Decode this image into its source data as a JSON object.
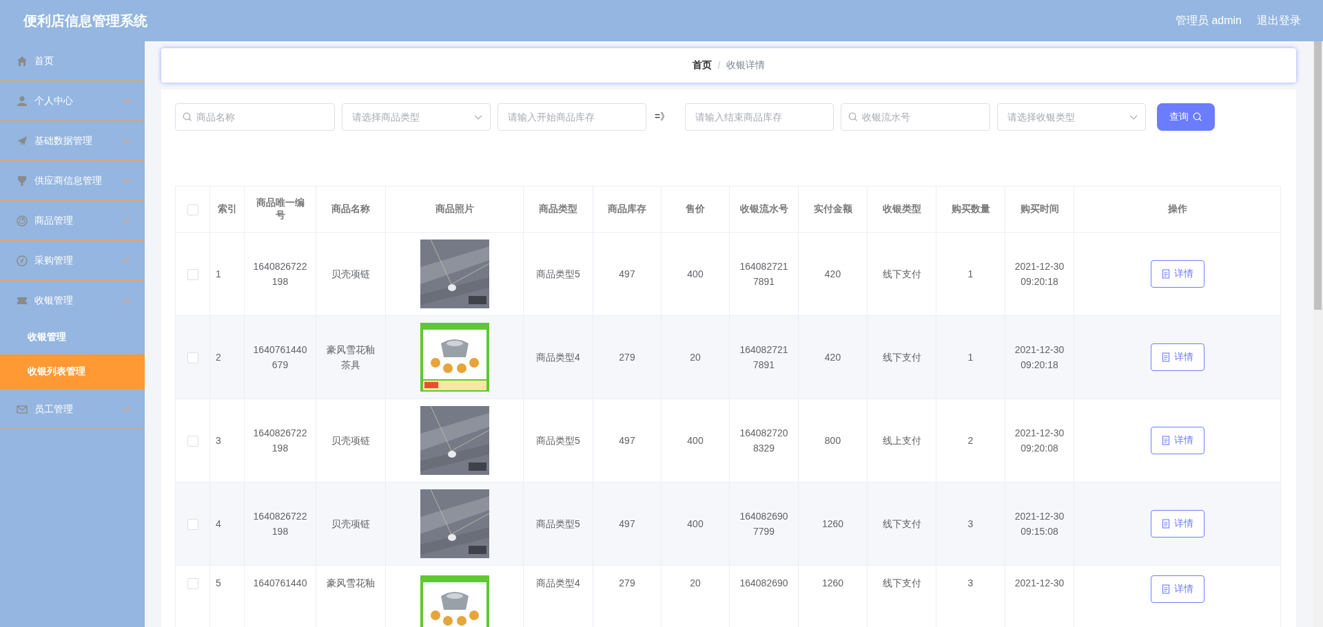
{
  "header": {
    "title": "便利店信息管理系统",
    "user": "管理员 admin",
    "logout": "退出登录"
  },
  "sidebar": {
    "items": [
      {
        "label": "首页",
        "selected": false
      },
      {
        "label": "个人中心",
        "expanded": false,
        "selected": false
      },
      {
        "label": "基础数据管理",
        "expanded": false,
        "selected": false
      },
      {
        "label": "供应商信息管理",
        "expanded": false,
        "selected": false
      },
      {
        "label": "商品管理",
        "expanded": false,
        "selected": false
      },
      {
        "label": "采购管理",
        "expanded": false,
        "selected": false
      },
      {
        "label": "收银管理",
        "expanded": true,
        "selected": false,
        "children": [
          {
            "label": "收银管理",
            "selected": false
          },
          {
            "label": "收银列表管理",
            "selected": true
          }
        ]
      },
      {
        "label": "员工管理",
        "expanded": false,
        "selected": false
      }
    ]
  },
  "breadcrumb": {
    "items": [
      "首页",
      "收银详情"
    ],
    "separator": "/"
  },
  "filters": [
    {
      "kind": "search",
      "placeholder": "商品名称"
    },
    {
      "kind": "select",
      "placeholder": "请选择商品类型"
    },
    {
      "kind": "input",
      "placeholder": "请输入开始商品库存"
    },
    {
      "kind": "text",
      "text": "=》"
    },
    {
      "kind": "input",
      "placeholder": "请输入结束商品库存"
    },
    {
      "kind": "search",
      "placeholder": "收银流水号"
    },
    {
      "kind": "select",
      "placeholder": "请选择收银类型"
    },
    {
      "kind": "button",
      "label": "查询"
    }
  ],
  "table": {
    "select_all_checked": false,
    "columns": [
      "索引",
      "商品唯一编号",
      "商品名称",
      "商品照片",
      "商品类型",
      "商品库存",
      "售价",
      "收银流水号",
      "实付金额",
      "收银类型",
      "购买数量",
      "购买时间",
      "操作"
    ],
    "rows": [
      {
        "checked": false,
        "cells": [
          "1",
          "1640826722198",
          "贝壳项链",
          {
            "kind": "picture"
          },
          "商品类型5",
          "497",
          "400",
          "1640827217891",
          "420",
          "线下支付",
          "1",
          "2021-12-30 09:20:18"
        ],
        "action": "详情"
      },
      {
        "checked": false,
        "cells": [
          "2",
          "1640761440679",
          "豪风雪花釉茶具",
          {
            "kind": "picture"
          },
          "商品类型4",
          "279",
          "20",
          "1640827217891",
          "420",
          "线下支付",
          "1",
          "2021-12-30 09:20:18"
        ],
        "action": "详情"
      },
      {
        "checked": false,
        "cells": [
          "3",
          "1640826722198",
          "贝壳项链",
          {
            "kind": "picture"
          },
          "商品类型5",
          "497",
          "400",
          "1640827208329",
          "800",
          "线上支付",
          "2",
          "2021-12-30 09:20:08"
        ],
        "action": "详情"
      },
      {
        "checked": false,
        "cells": [
          "4",
          "1640826722198",
          "贝壳项链",
          {
            "kind": "picture"
          },
          "商品类型5",
          "497",
          "400",
          "1640826907799",
          "1260",
          "线下支付",
          "3",
          "2021-12-30 09:15:08"
        ],
        "action": "详情"
      },
      {
        "checked": false,
        "cells": [
          "5",
          "1640761440",
          "豪风雪花釉",
          {
            "kind": "picture"
          },
          "商品类型4",
          "279",
          "20",
          "164082690",
          "1260",
          "线下支付",
          "3",
          "2021-12-30"
        ],
        "action": "详情"
      }
    ]
  }
}
